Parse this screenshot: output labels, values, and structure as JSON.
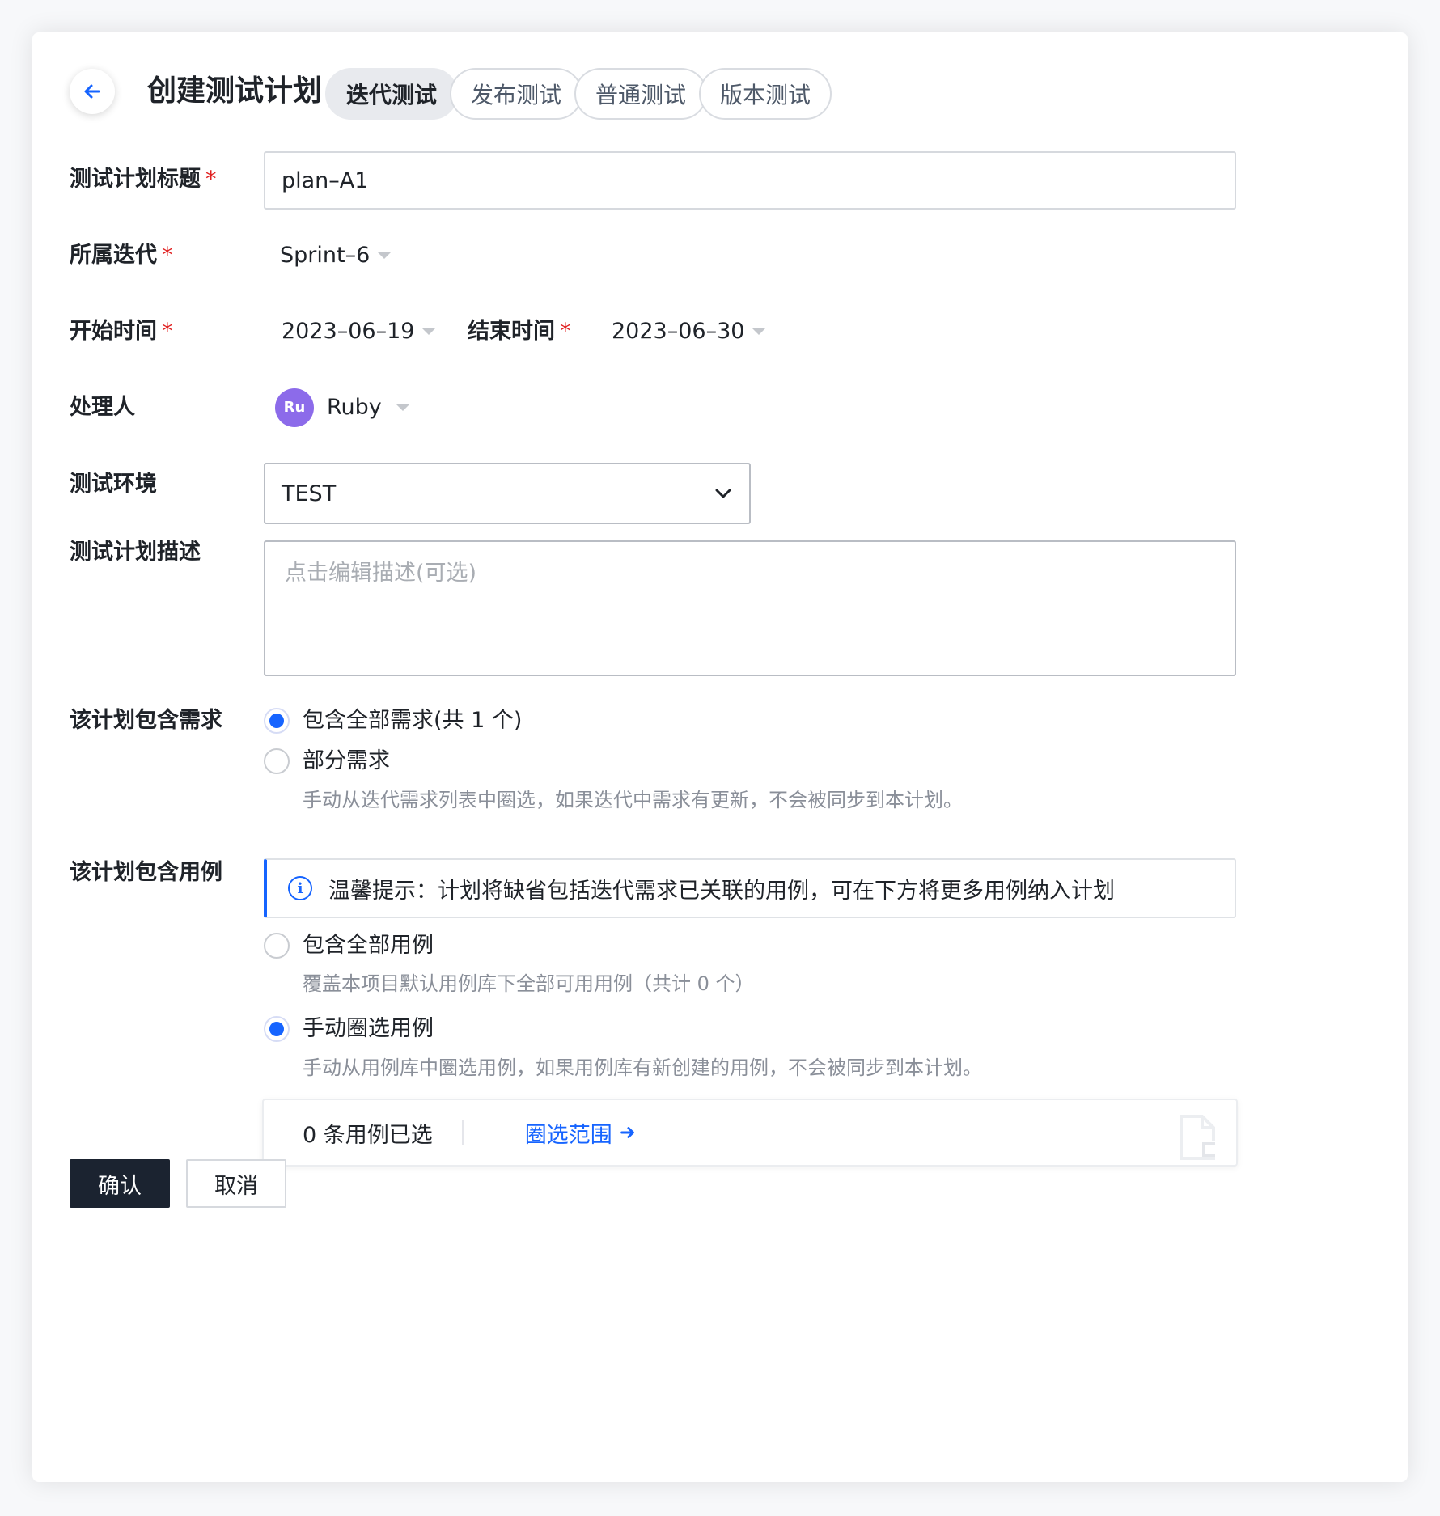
{
  "header": {
    "title": "创建测试计划",
    "tabs": [
      {
        "label": "迭代测试",
        "active": true
      },
      {
        "label": "发布测试",
        "active": false
      },
      {
        "label": "普通测试",
        "active": false
      },
      {
        "label": "版本测试",
        "active": false
      }
    ]
  },
  "form": {
    "plan_title": {
      "label": "测试计划标题",
      "required": "*",
      "value": "plan–A1"
    },
    "iteration": {
      "label": "所属迭代",
      "required": "*",
      "value": "Sprint–6"
    },
    "start_time": {
      "label": "开始时间",
      "required": "*",
      "value": "2023–06–19"
    },
    "end_time": {
      "label": "结束时间",
      "required": "*",
      "value": "2023–06–30"
    },
    "assignee": {
      "label": "处理人",
      "avatar_text": "Ru",
      "name": "Ruby",
      "avatar_color": "#8c6bea"
    },
    "environment": {
      "label": "测试环境",
      "value": "TEST"
    },
    "description": {
      "label": "测试计划描述",
      "placeholder": "点击编辑描述(可选)"
    },
    "requirements": {
      "label": "该计划包含需求",
      "options": [
        {
          "label": "包含全部需求(共 1 个)",
          "checked": true
        },
        {
          "label": "部分需求",
          "checked": false
        }
      ],
      "partial_hint": "手动从迭代需求列表中圈选，如果迭代中需求有更新，不会被同步到本计划。"
    },
    "cases": {
      "label": "该计划包含用例",
      "info": "温馨提示：计划将缺省包括迭代需求已关联的用例，可在下方将更多用例纳入计划",
      "options": [
        {
          "label": "包含全部用例",
          "checked": false,
          "hint": "覆盖本项目默认用例库下全部可用用例（共计 0 个）"
        },
        {
          "label": "手动圈选用例",
          "checked": true,
          "hint": "手动从用例库中圈选用例，如果用例库有新创建的用例，不会被同步到本计划。"
        }
      ],
      "selected_count": "0",
      "selected_text": "条用例已选",
      "select_scope_link": "圈选范围"
    }
  },
  "footer": {
    "confirm_label": "确认",
    "cancel_label": "取消"
  },
  "colors": {
    "accent": "#1664ff",
    "required": "#e02020",
    "primary_button": "#1b2330"
  }
}
